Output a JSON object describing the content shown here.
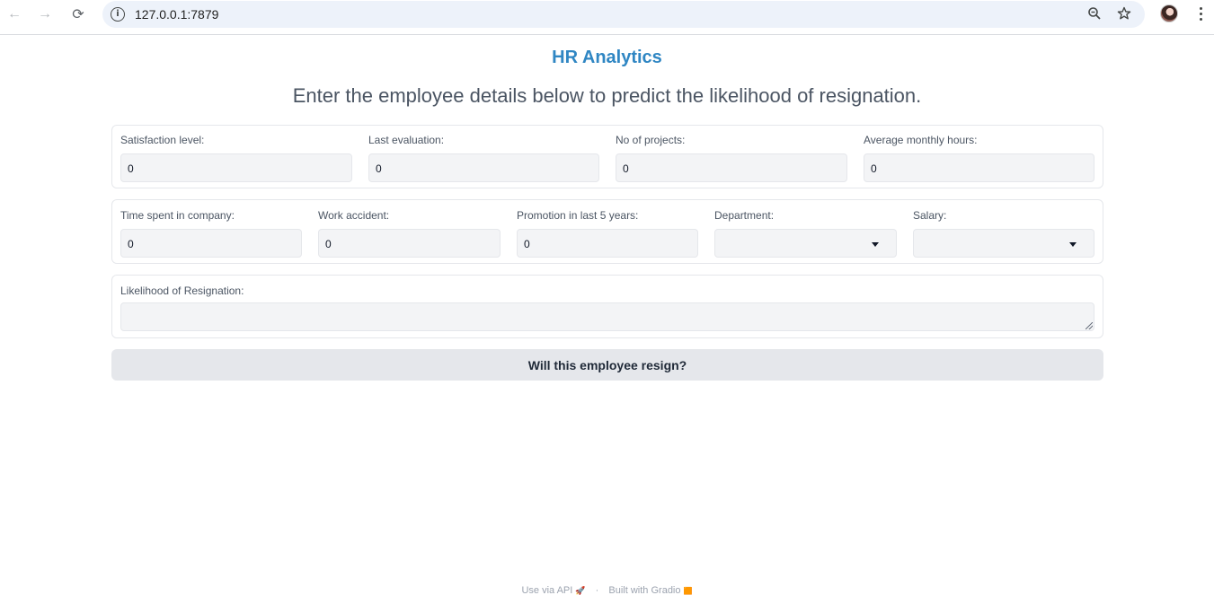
{
  "browser": {
    "url": "127.0.0.1:7879",
    "back_glyph": "←",
    "forward_glyph": "→",
    "reload_glyph": "⟳",
    "info_glyph": "i",
    "zoom_glyph": "⚲",
    "star_glyph": "☆",
    "icons": [
      "back-icon",
      "forward-icon",
      "reload-icon",
      "site-info-icon",
      "zoom-icon",
      "bookmark-star-icon",
      "profile-avatar",
      "menu-kebab-icon"
    ]
  },
  "app": {
    "title": "HR Analytics",
    "subtitle": "Enter the employee details below to predict the likelihood of resignation.",
    "accent_color": "#2f86c3"
  },
  "row1": {
    "satisfaction": {
      "label": "Satisfaction level:",
      "value": "0"
    },
    "last_evaluation": {
      "label": "Last evaluation:",
      "value": "0"
    },
    "projects": {
      "label": "No of projects:",
      "value": "0"
    },
    "monthly_hours": {
      "label": "Average monthly hours:",
      "value": "0"
    }
  },
  "row2": {
    "time_spent": {
      "label": "Time spent in company:",
      "value": "0"
    },
    "work_accident": {
      "label": "Work accident:",
      "value": "0"
    },
    "promotion": {
      "label": "Promotion in last 5 years:",
      "value": "0"
    },
    "department": {
      "label": "Department:",
      "value": ""
    },
    "salary": {
      "label": "Salary:",
      "value": ""
    }
  },
  "output": {
    "label": "Likelihood of Resignation:",
    "value": ""
  },
  "submit": {
    "label": "Will this employee resign?"
  },
  "footer": {
    "api": "Use via API",
    "api_emoji": "🚀",
    "separator": "·",
    "built": "Built with Gradio",
    "built_emoji": "🟧"
  }
}
